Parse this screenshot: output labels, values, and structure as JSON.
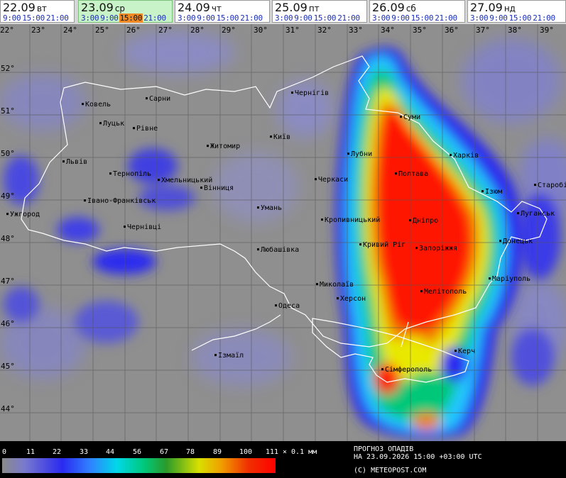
{
  "days": [
    {
      "date": "22.09",
      "dow": "вт",
      "times": [
        "9:00",
        "15:00",
        "21:00"
      ],
      "active": false,
      "selected": null
    },
    {
      "date": "23.09",
      "dow": "ср",
      "times": [
        "3:00",
        "9:00",
        "15:00",
        "21:00"
      ],
      "active": true,
      "selected": "15:00"
    },
    {
      "date": "24.09",
      "dow": "чт",
      "times": [
        "3:00",
        "9:00",
        "15:00",
        "21:00"
      ],
      "active": false,
      "selected": null
    },
    {
      "date": "25.09",
      "dow": "пт",
      "times": [
        "3:00",
        "9:00",
        "15:00",
        "21:00"
      ],
      "active": false,
      "selected": null
    },
    {
      "date": "26.09",
      "dow": "сб",
      "times": [
        "3:00",
        "9:00",
        "15:00",
        "21:00"
      ],
      "active": false,
      "selected": null
    },
    {
      "date": "27.09",
      "dow": "нд",
      "times": [
        "3:00",
        "9:00",
        "15:00",
        "21:00"
      ],
      "active": false,
      "selected": null
    }
  ],
  "map": {
    "lon_labels": [
      "22°",
      "23°",
      "24°",
      "25°",
      "26°",
      "27°",
      "28°",
      "29°",
      "30°",
      "31°",
      "32°",
      "33°",
      "34°",
      "35°",
      "36°",
      "37°",
      "38°",
      "39°"
    ],
    "lat_labels": [
      "52°",
      "51°",
      "50°",
      "49°",
      "48°",
      "47°",
      "46°",
      "45°",
      "44°"
    ],
    "cities": [
      "Ковель",
      "Сарни",
      "Чернігів",
      "Суми",
      "Луцьк",
      "Рівне",
      "Київ",
      "Житомир",
      "Лубни",
      "Харків",
      "Львів",
      "Тернопіль",
      "Хмельницький",
      "Вінниця",
      "Черкаси",
      "Полтава",
      "Ізюм",
      "Старобільськ",
      "Івано-Франківськ",
      "Ужгород",
      "Умань",
      "Луганськ",
      "Чернівці",
      "Кропивницький",
      "Дніпро",
      "Донецьк",
      "Кривий Ріг",
      "Запоріжжя",
      "Любашівка",
      "Маріуполь",
      "Миколаїв",
      "Мелітополь",
      "Херсон",
      "Одеса",
      "Ізмаїл",
      "Керч",
      "Сімферополь"
    ]
  },
  "legend": {
    "ticks": [
      "0",
      "11",
      "22",
      "33",
      "44",
      "56",
      "67",
      "78",
      "89",
      "100",
      "111"
    ],
    "unit": "× 0.1 мм",
    "title": "ПРОГНОЗ ОПАДІВ",
    "valid": "НА 23.09.2026 15:00 +03:00 UTC",
    "copyright": "(C) METEOPOST.COM"
  }
}
